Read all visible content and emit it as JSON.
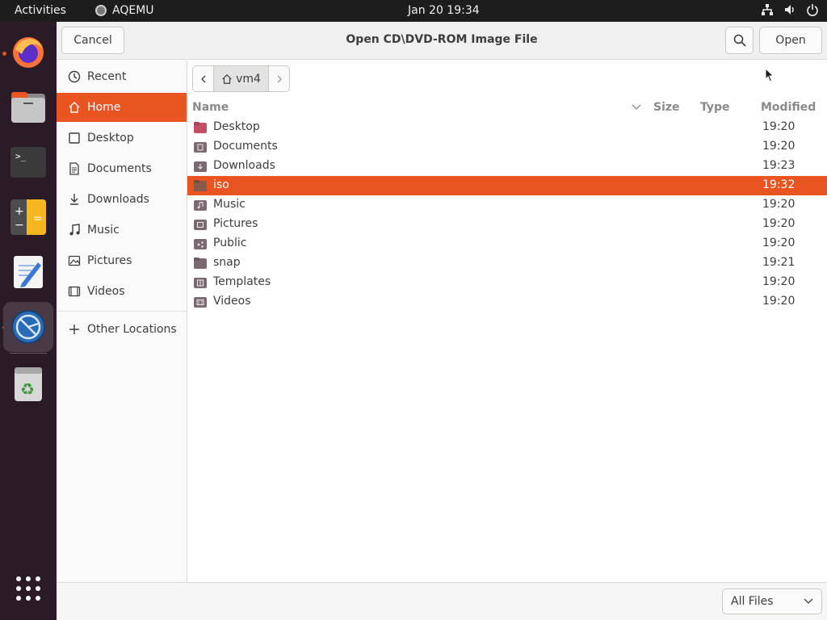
{
  "topbar": {
    "activities": "Activities",
    "app_name": "AQEMU",
    "clock": "Jan 20  19:34"
  },
  "dock": {
    "apps": [
      "firefox-icon",
      "files-icon",
      "terminal-icon",
      "calculator-icon",
      "text-editor-icon",
      "aqemu-icon",
      "trash-icon",
      "app-grid-icon"
    ]
  },
  "dialog": {
    "title": "Open CD\\DVD-ROM Image File",
    "cancel_label": "Cancel",
    "open_label": "Open"
  },
  "sidebar": {
    "items": [
      {
        "label": "Recent",
        "icon": "clock-icon"
      },
      {
        "label": "Home",
        "icon": "home-icon"
      },
      {
        "label": "Desktop",
        "icon": "desktop-icon"
      },
      {
        "label": "Documents",
        "icon": "document-icon"
      },
      {
        "label": "Downloads",
        "icon": "download-icon"
      },
      {
        "label": "Music",
        "icon": "music-icon"
      },
      {
        "label": "Pictures",
        "icon": "picture-icon"
      },
      {
        "label": "Videos",
        "icon": "video-icon"
      },
      {
        "label": "Other Locations",
        "icon": "plus-icon"
      }
    ],
    "selected": "Home"
  },
  "pathbar": {
    "current": "vm4"
  },
  "columns": {
    "name": "Name",
    "size": "Size",
    "type": "Type",
    "modified": "Modified"
  },
  "files": [
    {
      "name": "Desktop",
      "modified": "19:20"
    },
    {
      "name": "Documents",
      "modified": "19:20"
    },
    {
      "name": "Downloads",
      "modified": "19:23"
    },
    {
      "name": "iso",
      "modified": "19:32"
    },
    {
      "name": "Music",
      "modified": "19:20"
    },
    {
      "name": "Pictures",
      "modified": "19:20"
    },
    {
      "name": "Public",
      "modified": "19:20"
    },
    {
      "name": "snap",
      "modified": "19:21"
    },
    {
      "name": "Templates",
      "modified": "19:20"
    },
    {
      "name": "Videos",
      "modified": "19:20"
    }
  ],
  "selected_file": "iso",
  "footer": {
    "filter_label": "All Files"
  },
  "colors": {
    "accent": "#e95420",
    "topbar": "#1d1d1d",
    "dock": "#2b1b26"
  }
}
